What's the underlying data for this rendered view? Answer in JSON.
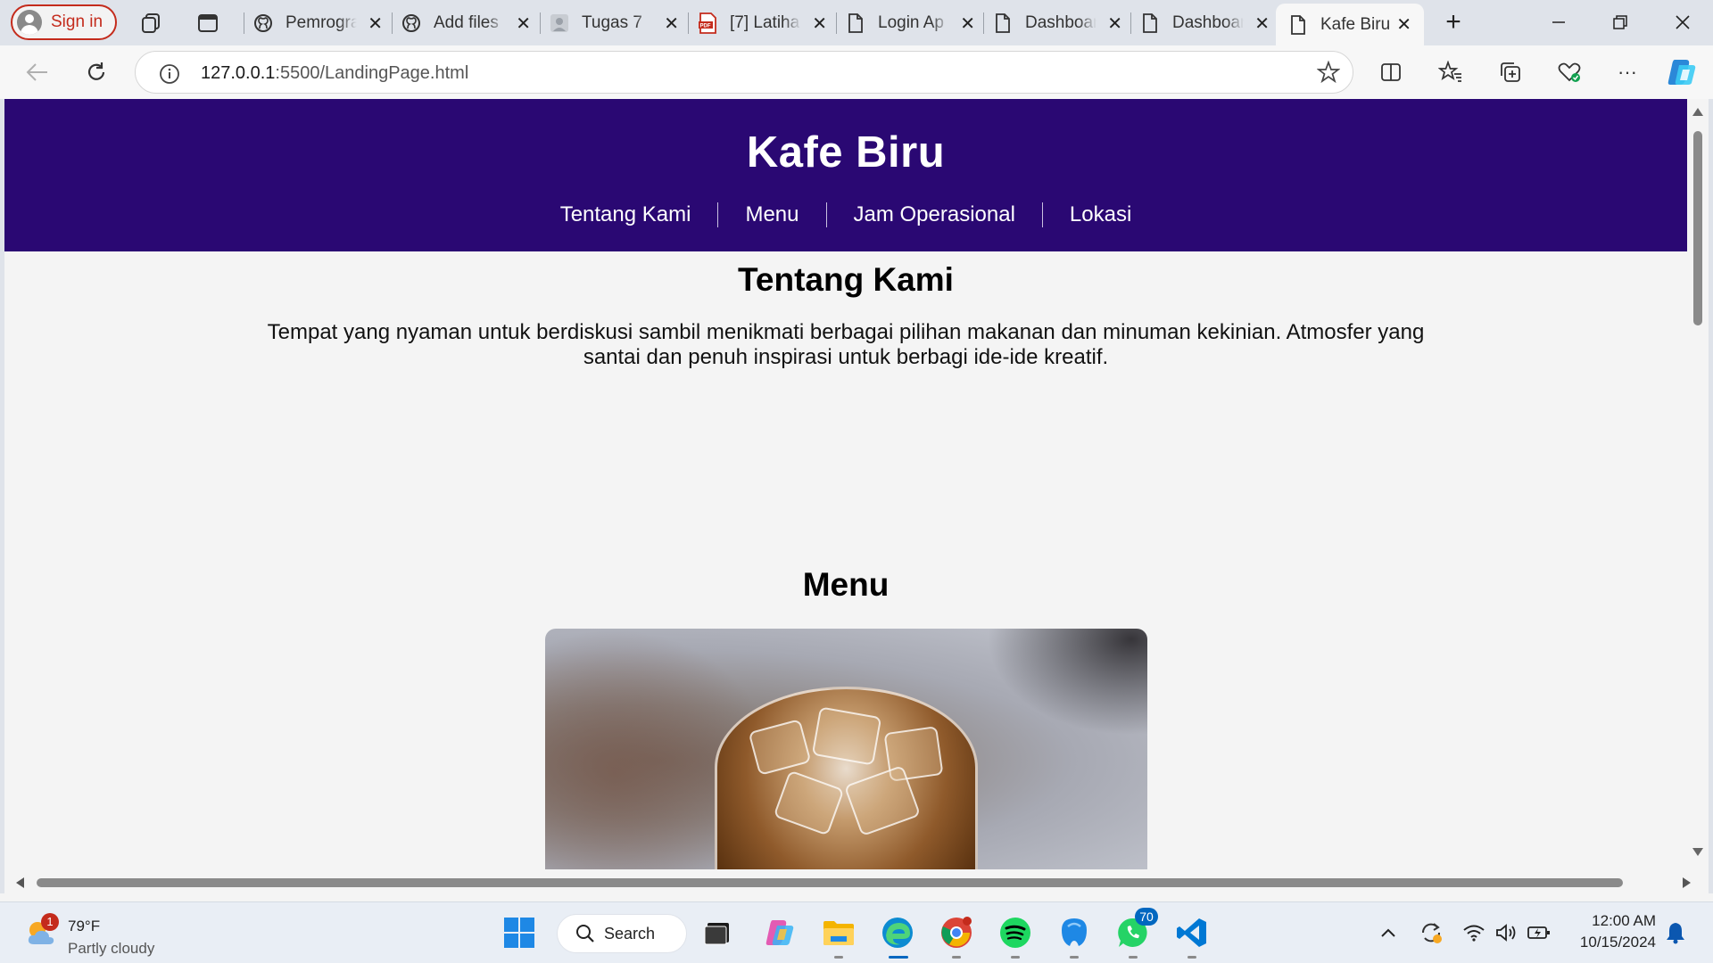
{
  "browser": {
    "sign_in_label": "Sign in",
    "tabs": [
      {
        "title": "Pemrogra",
        "favicon": "github-icon"
      },
      {
        "title": "Add files",
        "favicon": "github-icon"
      },
      {
        "title": "Tugas 7",
        "favicon": "avatar-icon"
      },
      {
        "title": "[7] Latiha",
        "favicon": "pdf-icon"
      },
      {
        "title": "Login Ap",
        "favicon": "document-icon"
      },
      {
        "title": "Dashboar",
        "favicon": "document-icon"
      },
      {
        "title": "Dashboar",
        "favicon": "document-icon"
      },
      {
        "title": "Kafe Biru",
        "favicon": "document-icon",
        "active": true
      }
    ],
    "url_host": "127.0.0.1",
    "url_rest": ":5500/LandingPage.html"
  },
  "site": {
    "title": "Kafe Biru",
    "nav": [
      "Tentang Kami",
      "Menu",
      "Jam Operasional",
      "Lokasi"
    ],
    "about": {
      "heading": "Tentang Kami",
      "text": "Tempat yang nyaman untuk berdiskusi sambil menikmati berbagai pilihan makanan dan minuman kekinian. Atmosfer yang santai dan penuh inspirasi untuk berbagi ide-ide kreatif."
    },
    "menu": {
      "heading": "Menu",
      "image": "iced-coffee-photo"
    },
    "colors": {
      "header_bg": "#2a0873",
      "page_bg": "#f4f4f4"
    }
  },
  "taskbar": {
    "weather": {
      "temp": "79°F",
      "condition": "Partly cloudy",
      "badge": "1"
    },
    "search_label": "Search",
    "whatsapp_badge": "70",
    "clock": {
      "time": "12:00 AM",
      "date": "10/15/2024"
    }
  }
}
